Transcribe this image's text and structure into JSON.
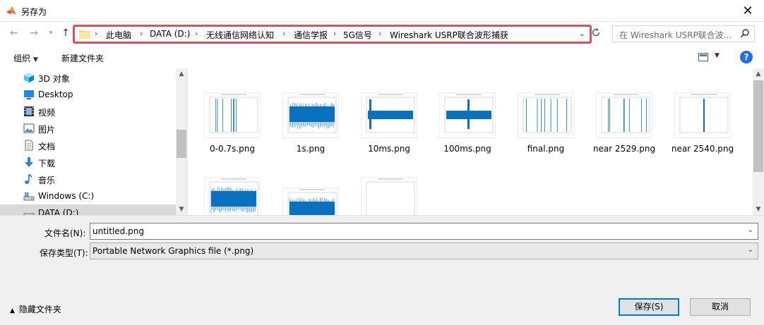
{
  "window": {
    "title": "另存为"
  },
  "nav": {
    "back_icon": "back-arrow-icon",
    "forward_icon": "forward-arrow-icon",
    "recent_icon": "chevron-down-icon",
    "up_icon": "up-arrow-icon",
    "breadcrumb": [
      "此电脑",
      "DATA (D:)",
      "无线通信网络认知",
      "通信学报",
      "5G信号",
      "Wireshark USRP联合波形捕获"
    ],
    "search_placeholder": "在 Wireshark USRP联合波...",
    "accent": "#e94b5c"
  },
  "toolbar": {
    "organize": "组织",
    "new_folder": "新建文件夹",
    "help": "?"
  },
  "sidebar": {
    "items": [
      {
        "label": "3D 对象",
        "icon": "3d-objects-icon"
      },
      {
        "label": "Desktop",
        "icon": "desktop-icon"
      },
      {
        "label": "视频",
        "icon": "video-icon"
      },
      {
        "label": "图片",
        "icon": "pictures-icon"
      },
      {
        "label": "文档",
        "icon": "documents-icon"
      },
      {
        "label": "下载",
        "icon": "download-icon"
      },
      {
        "label": "音乐",
        "icon": "music-icon"
      },
      {
        "label": "Windows (C:)",
        "icon": "drive-icon"
      },
      {
        "label": "DATA (D:)",
        "icon": "drive-icon"
      }
    ]
  },
  "files": [
    {
      "name": "0-0.7s.png",
      "kind": "sparse"
    },
    {
      "name": "1s.png",
      "kind": "dense"
    },
    {
      "name": "10ms.png",
      "kind": "burst"
    },
    {
      "name": "100ms.png",
      "kind": "burst2"
    },
    {
      "name": "final.png",
      "kind": "sparse"
    },
    {
      "name": "near 2529.png",
      "kind": "sparse"
    },
    {
      "name": "near 2540.png",
      "kind": "single"
    },
    {
      "name": "",
      "kind": "dense"
    },
    {
      "name": "",
      "kind": "dense"
    },
    {
      "name": "",
      "kind": "empty"
    }
  ],
  "form": {
    "filename_label": "文件名(N):",
    "filename_value": "untitled.png",
    "filetype_label": "保存类型(T):",
    "filetype_value": "Portable Network Graphics file (*.png)"
  },
  "footer": {
    "hide_folders": "隐藏文件夹",
    "save": "保存(S)",
    "cancel": "取消"
  }
}
